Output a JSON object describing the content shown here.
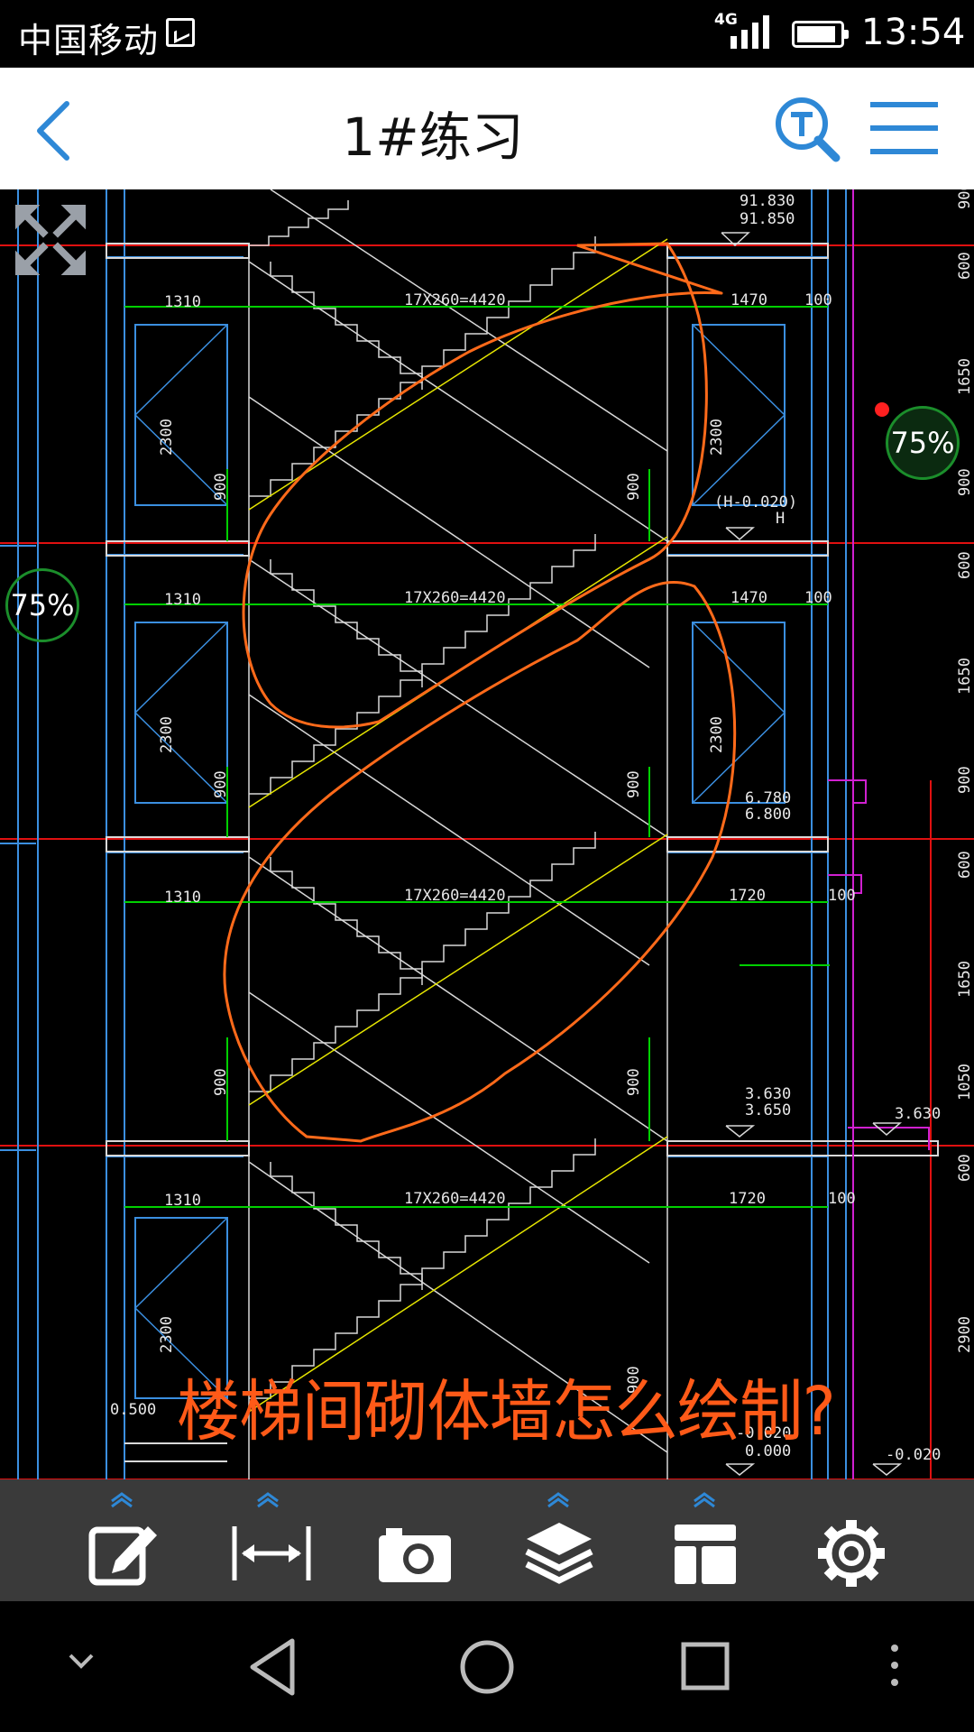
{
  "status_bar": {
    "carrier": "中国移动",
    "network": "4G",
    "time": "13:54"
  },
  "app_bar": {
    "title": "1#练习",
    "back_icon": "chevron-left-icon",
    "search_icon": "t-search-icon",
    "menu_icon": "hamburger-menu-icon"
  },
  "viewer": {
    "zoom_right": "75%",
    "zoom_left": "75%",
    "annotation_question": "楼梯间砌体墙怎么绘制?",
    "drawing_labels": {
      "stair_spec": "17X260=4420",
      "w1310": "1310",
      "w1470": "1470",
      "w1720": "1720",
      "d100": "100",
      "h2300": "2300",
      "h900": "900",
      "elev_91830": "91.830",
      "elev_91850": "91.850",
      "elev_h0020": "(H-0.020)",
      "elev_h": "H",
      "elev_6780": "6.780",
      "elev_6800": "6.800",
      "elev_3630": "3.630",
      "elev_3650": "3.650",
      "elev_0500": "0.500",
      "elev_m0020": "-0.020",
      "elev_0000": "0.000",
      "dim_900": "900",
      "dim_600": "600",
      "dim_1650": "1650",
      "dim_1050": "1050",
      "dim_2900": "2900"
    },
    "colors": {
      "annotation": "#ff5a18",
      "axis_red": "#e01010",
      "dim_green": "#00d000",
      "wall_blue": "#3b8fe0",
      "stair_white": "#d8d8d8",
      "yellow": "#e6e600",
      "magenta": "#d020d0"
    }
  },
  "toolbar": {
    "items": [
      "edit-icon",
      "measure-icon",
      "camera-icon",
      "layers-icon",
      "layout-icon",
      "settings-icon"
    ]
  },
  "nav_bar": {
    "items": [
      "collapse-icon",
      "back-triangle-icon",
      "home-circle-icon",
      "recents-square-icon",
      "more-dots-icon"
    ]
  }
}
